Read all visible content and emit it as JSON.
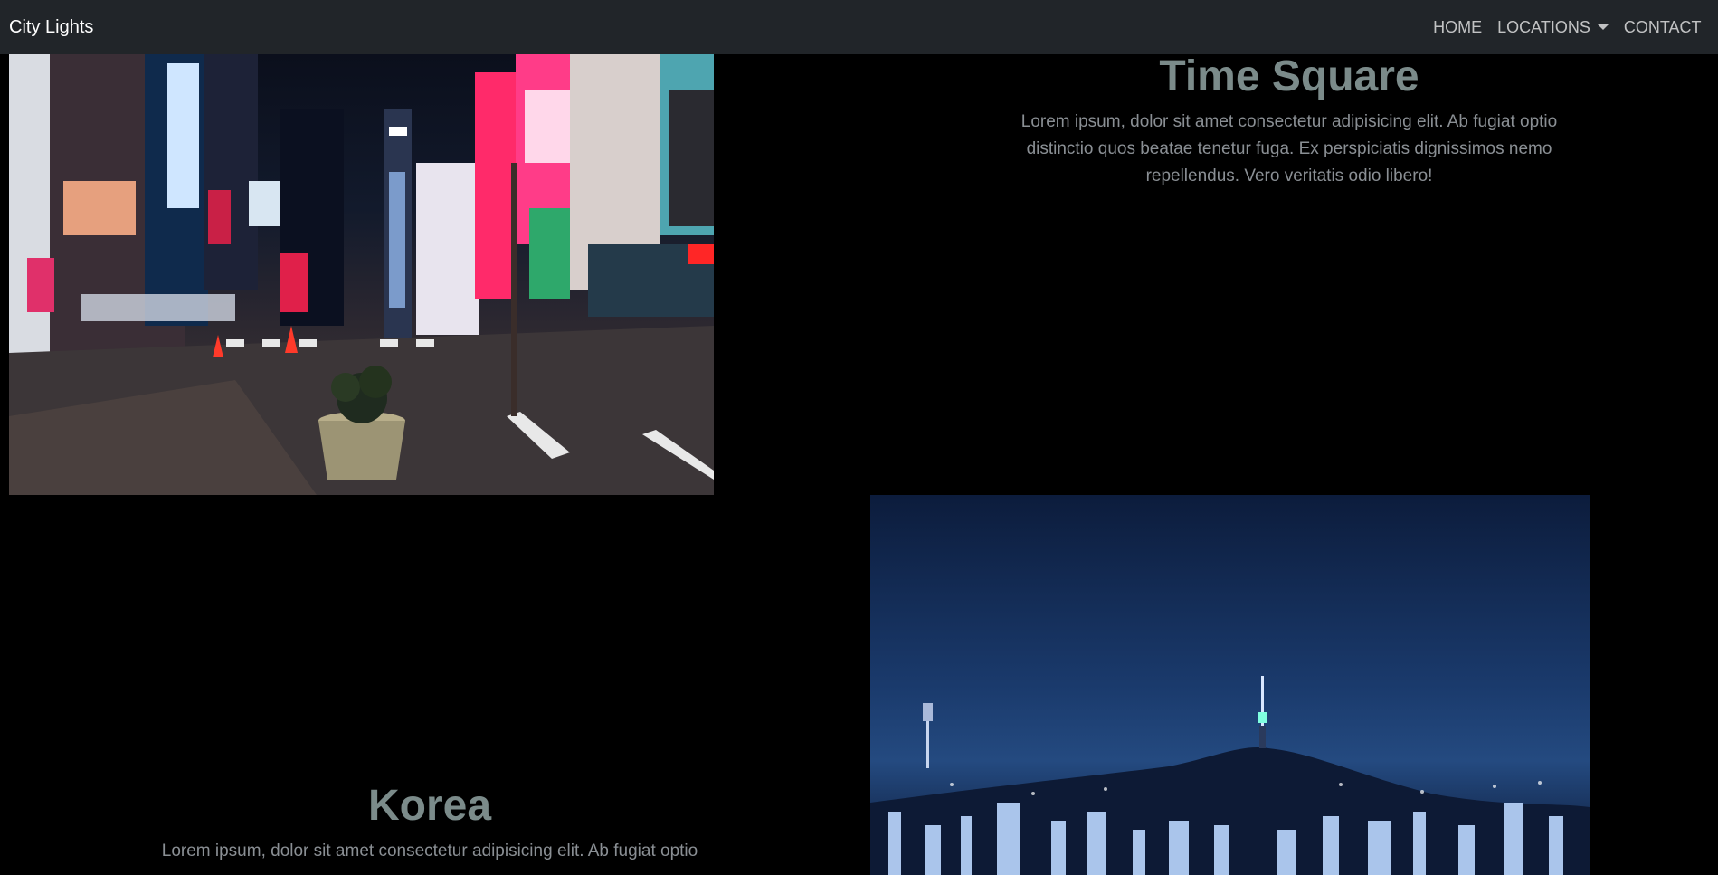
{
  "navbar": {
    "brand": "City Lights",
    "links": {
      "home": "HOME",
      "locations": "LOCATIONS",
      "contact": "CONTACT"
    }
  },
  "sections": [
    {
      "title": "Time Square",
      "description": "Lorem ipsum, dolor sit amet consectetur adipisicing elit. Ab fugiat optio distinctio quos beatae tenetur fuga. Ex perspiciatis dignissimos nemo repellendus. Vero veritatis odio libero!"
    },
    {
      "title": "Korea",
      "description": "Lorem ipsum, dolor sit amet consectetur adipisicing elit. Ab fugiat optio"
    }
  ],
  "colors": {
    "navbar_bg": "#212529",
    "page_bg": "#000000",
    "title": "#7b8b8a",
    "text": "#8a8f94"
  }
}
